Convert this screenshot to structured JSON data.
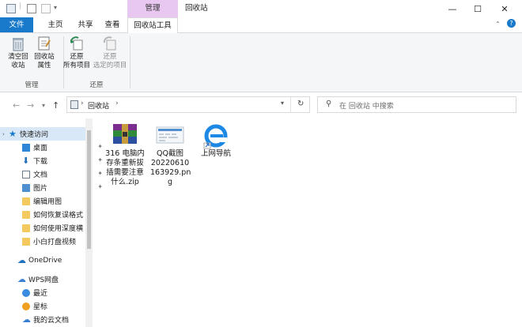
{
  "window": {
    "context_tab_header": "管理",
    "title": "回收站"
  },
  "tabs": {
    "file": "文件",
    "home": "主页",
    "share": "共享",
    "view": "查看",
    "recycle_tools": "回收站工具"
  },
  "ribbon": {
    "empty_line1": "清空回",
    "empty_line2": "收站",
    "props_line1": "回收站",
    "props_line2": "属性",
    "group_manage": "管理",
    "restore_all_line1": "还原",
    "restore_all_line2": "所有项目",
    "restore_sel_line1": "还原",
    "restore_sel_line2": "选定的项目",
    "group_restore": "还原"
  },
  "address": {
    "location": "回收站",
    "search_placeholder": "在 回收站 中搜索"
  },
  "nav": {
    "quick_access": "快速访问",
    "desktop": "桌面",
    "downloads": "下载",
    "documents": "文档",
    "pictures": "图片",
    "f1": "编辑用图",
    "f2": "如何恢复误格式",
    "f3": "如何使用深度横",
    "f4": "小白打盘视频",
    "onedrive": "OneDrive",
    "wps": "WPS网盘",
    "recent": "最近",
    "starred": "星标",
    "mycloud": "我的云文档"
  },
  "files": [
    {
      "line1": "316 电脑内",
      "line2": "存条重新拔",
      "line3": "插需要注意",
      "line4": "什么.zip"
    },
    {
      "line1": "QQ截图",
      "line2": "20220610",
      "line3": "163929.pn",
      "line4": "g"
    },
    {
      "line1": "上网导航",
      "line2": "",
      "line3": "",
      "line4": ""
    }
  ],
  "colors": {
    "file_tab": "#1979ca",
    "context_header": "#e8c8f0",
    "selection": "#d9e8f7"
  }
}
